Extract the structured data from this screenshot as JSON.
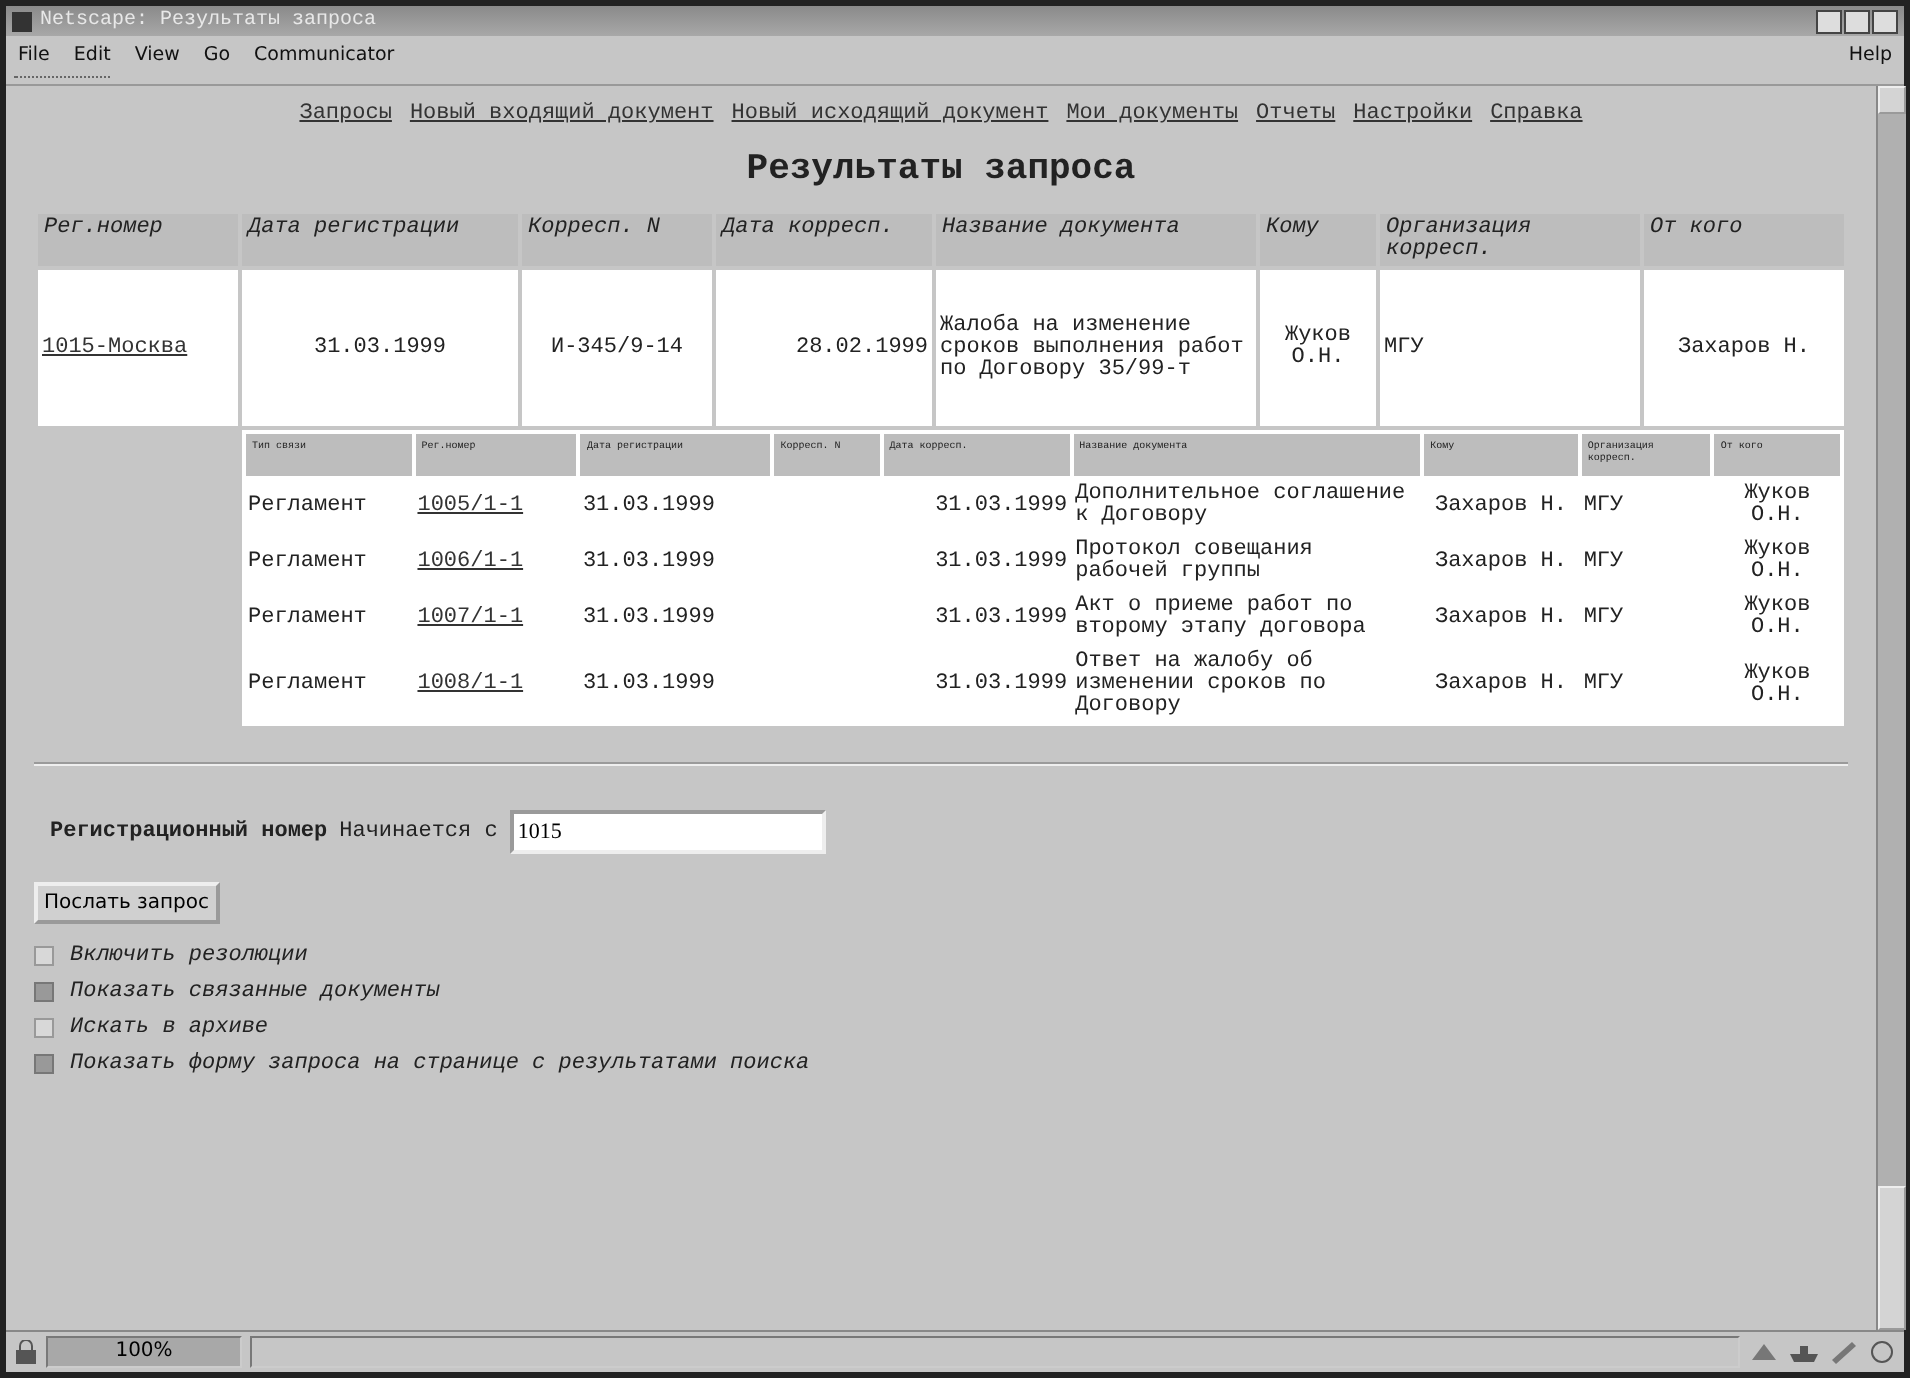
{
  "window": {
    "title": "Netscape: Результаты запроса"
  },
  "menu": {
    "items": [
      "File",
      "Edit",
      "View",
      "Go",
      "Communicator"
    ],
    "help": "Help"
  },
  "nav_links": [
    "Запросы",
    "Новый входящий документ",
    "Новый исходящий документ",
    "Мои документы",
    "Отчеты",
    "Настройки",
    "Справка"
  ],
  "heading": "Результаты запроса",
  "results_table": {
    "columns": [
      "Рег.номер",
      "Дата регистрации",
      "Корресп. N",
      "Дата корресп.",
      "Название документа",
      "Кому",
      "Организация корресп.",
      "От кого"
    ],
    "rows": [
      {
        "reg_number": "1015-Москва",
        "reg_date": "31.03.1999",
        "corr_number": "И-345/9-14",
        "corr_date": "28.02.1999",
        "doc_name": "Жалоба на изменение сроков выполнения работ по Договору 35/99-т",
        "to": "Жуков О.Н.",
        "org": "МГУ",
        "from": "Захаров Н."
      }
    ]
  },
  "related_table": {
    "columns": [
      "Тип связи",
      "Рег.номер",
      "Дата регистрации",
      "Корресп. N",
      "Дата корресп.",
      "Название документа",
      "Кому",
      "Организация корресп.",
      "От кого"
    ],
    "rows": [
      {
        "link_type": "Регламент",
        "reg_number": "1005/1-1",
        "reg_date": "31.03.1999",
        "corr_date": "31.03.1999",
        "doc_name": "Дополнительное соглашение к Договору",
        "to": "Захаров Н.",
        "org": "МГУ",
        "from": "Жуков О.Н."
      },
      {
        "link_type": "Регламент",
        "reg_number": "1006/1-1",
        "reg_date": "31.03.1999",
        "corr_date": "31.03.1999",
        "doc_name": "Протокол совещания рабочей группы",
        "to": "Захаров Н.",
        "org": "МГУ",
        "from": "Жуков О.Н."
      },
      {
        "link_type": "Регламент",
        "reg_number": "1007/1-1",
        "reg_date": "31.03.1999",
        "corr_date": "31.03.1999",
        "doc_name": "Акт о приеме работ по второму этапу договора",
        "to": "Захаров Н.",
        "org": "МГУ",
        "from": "Жуков О.Н."
      },
      {
        "link_type": "Регламент",
        "reg_number": "1008/1-1",
        "reg_date": "31.03.1999",
        "corr_date": "31.03.1999",
        "doc_name": "Ответ на жалобу об изменении сроков по Договору",
        "to": "Захаров Н.",
        "org": "МГУ",
        "from": "Жуков О.Н."
      }
    ]
  },
  "form": {
    "field_label": "Регистрационный номер",
    "field_condition": "Начинается с",
    "value": "1015",
    "submit": "Послать запрос",
    "options": [
      {
        "label": "Включить резолюции",
        "checked": false
      },
      {
        "label": "Показать связанные документы",
        "checked": true
      },
      {
        "label": "Искать в архиве",
        "checked": false
      },
      {
        "label": "Показать форму запроса на странице с результатами поиска",
        "checked": true
      }
    ]
  },
  "status_bar": {
    "zoom": "100%"
  }
}
